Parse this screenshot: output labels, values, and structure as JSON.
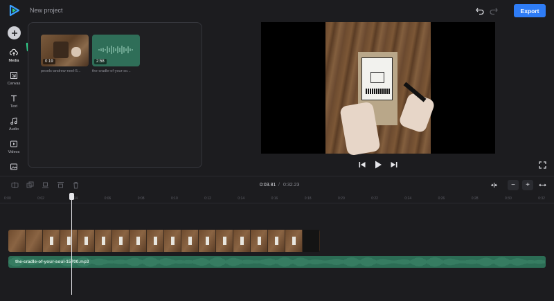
{
  "app": {
    "project_title": "New project",
    "export_label": "Export"
  },
  "sidebar": {
    "items": [
      {
        "label": "Media",
        "icon": "cloud-upload-icon"
      },
      {
        "label": "Canvas",
        "icon": "canvas-icon"
      },
      {
        "label": "Text",
        "icon": "text-icon"
      },
      {
        "label": "Audio",
        "icon": "music-note-icon"
      },
      {
        "label": "Videos",
        "icon": "video-icon"
      }
    ]
  },
  "media": {
    "items": [
      {
        "name": "pexels-andrew-neel-5...",
        "duration": "0:19",
        "type": "video"
      },
      {
        "name": "the-cradle-of-your-so...",
        "duration": "2:58",
        "type": "audio"
      }
    ]
  },
  "player": {
    "current_time": "0:03.81",
    "separator": "/",
    "total_time": "0:32.23"
  },
  "ruler": {
    "ticks": [
      "0:00",
      "0:02",
      "0:04",
      "0:06",
      "0:08",
      "0:10",
      "0:12",
      "0:14",
      "0:16",
      "0:18",
      "0:20",
      "0:22",
      "0:24",
      "0:26",
      "0:28",
      "0:30",
      "0:32"
    ]
  },
  "timeline": {
    "audio_clip_name": "the-cradle-of-your-soul-15700.mp3",
    "zoom_out_label": "−",
    "zoom_in_label": "+"
  },
  "colors": {
    "accent": "#2e7cf6",
    "audio_clip": "#2c6d55",
    "arrow": "#2fd18a"
  }
}
